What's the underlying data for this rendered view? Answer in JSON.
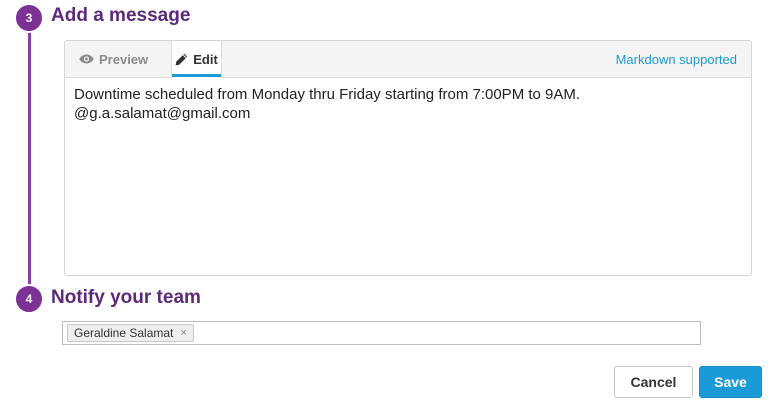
{
  "steps": {
    "message": {
      "number": "3",
      "title": "Add a message"
    },
    "notify": {
      "number": "4",
      "title": "Notify your team"
    }
  },
  "editor": {
    "tabs": {
      "preview_label": "Preview",
      "edit_label": "Edit",
      "active": "edit"
    },
    "markdown_label": "Markdown supported",
    "content": "Downtime scheduled from Monday thru Friday starting from 7:00PM to 9AM.\n@g.a.salamat@gmail.com"
  },
  "notify": {
    "tags": [
      {
        "label": "Geraldine Salamat",
        "remove_symbol": "×"
      }
    ]
  },
  "actions": {
    "cancel_label": "Cancel",
    "save_label": "Save"
  },
  "icons": {
    "preview": "eye-icon",
    "edit": "pencil-icon",
    "remove_tag": "close-icon"
  },
  "colors": {
    "accent_purple": "#7b3294",
    "title_purple": "#5d2a79",
    "accent_blue": "#1a9bd7"
  }
}
